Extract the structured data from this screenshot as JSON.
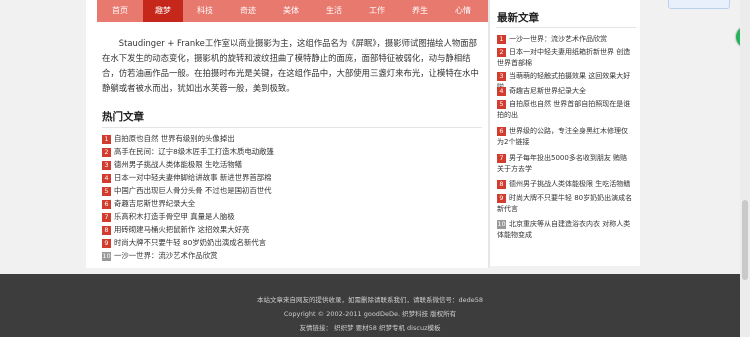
{
  "nav": [
    "首页",
    "趣梦",
    "科技",
    "奇迹",
    "美体",
    "生活",
    "工作",
    "养生",
    "心情"
  ],
  "intro": "Staudinger + Franke工作室以商业摄影为主，这组作品名为《屏眠》，摄影师试图描绘人物面部在水下发生的动态变化，摄影机的旋转和波纹扭曲了模特静止的面庞，面部特征被弱化，动与静相结合，仿若油画作品一般。在拍摄时布光是关键，在这组作品中，大部使用三盏灯来布光，让模特在水中静躺或者被水而出，犹如出水芙蓉一般，美到极致。",
  "hot": {
    "title": "热门文章",
    "items": [
      {
        "n": "1",
        "text": "自拍原也自然 世界有级别的头像掉出"
      },
      {
        "n": "2",
        "text": "高手在民间：辽宁8级木匠手工打造木质电动敞篷"
      },
      {
        "n": "3",
        "text": "德州男子挑战人类体能极限 生吃活物鳝"
      },
      {
        "n": "4",
        "text": "日本一对中轻夫妻伸脚给讲故事 新进世界首部棉"
      },
      {
        "n": "5",
        "text": "中国广西出现巨人骨分头骨 不过也是国初百世代"
      },
      {
        "n": "6",
        "text": "奇趣吉尼斯世界纪录大全"
      },
      {
        "n": "7",
        "text": "乐高积木打造手骨空甲 真量是人脑极"
      },
      {
        "n": "8",
        "text": "用砖砌建马桶火把鼠新作 这招效果大好亮"
      },
      {
        "n": "9",
        "text": "时尚大牌不只要牛轻 80岁奶奶出演成名新代言"
      },
      {
        "n": "10",
        "text": "一沙一世界：流沙艺术作品欣赏"
      }
    ]
  },
  "side": {
    "title": "最新文章",
    "items": [
      {
        "n": "1",
        "text": "一沙一世界：流沙艺术作品欣赏"
      },
      {
        "n": "2",
        "text": "日本一对中轻夫妻用纸箱折新世界 创造世界首部棉"
      },
      {
        "n": "3",
        "text": "当萌萌的轻触式拍摄效果 这回效果大好啦"
      },
      {
        "n": "4",
        "text": "奇趣吉尼斯世界纪录大全"
      },
      {
        "n": "5",
        "text": "自拍原也自然 世界首部自拍照现在是谁拍的出"
      },
      {
        "n": "6",
        "text": "世界级的公路，专注全身黑红木修理仅为2个链接"
      },
      {
        "n": "7",
        "text": "男子每年投出5000多名收到朋友 贿赂关于方去学"
      },
      {
        "n": "8",
        "text": "德州男子挑战人类体能极限 生吃活物鳝"
      },
      {
        "n": "9",
        "text": "时尚大牌不只要牛轻 80岁奶奶出演成名新代言"
      },
      {
        "n": "10",
        "text": "北京重庆等从自建造浴衣内衣 对称人类体能物变成"
      }
    ]
  },
  "footer": {
    "line1": "本站文章来自网友的提供收录，如需删除请联系我们，请联系微信号：dede58",
    "line2": "Copyright © 2002-2011 goodDeDe. 织梦科技 版权所有",
    "line3": "友情链接：  织织梦   要材58   织梦专机   discuz模板"
  }
}
